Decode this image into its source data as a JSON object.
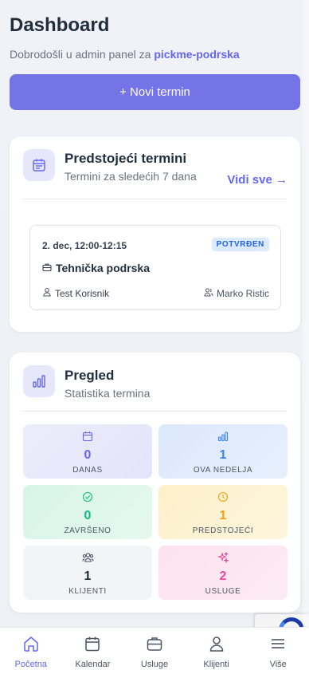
{
  "header": {
    "title": "Dashboard",
    "welcome": "Dobrodošli u admin panel za",
    "org": "pickme-podrska",
    "new_button": "+ Novi termin"
  },
  "upcoming": {
    "title": "Predstojeći termini",
    "subtitle": "Termini za sledećih 7 dana",
    "see_all": "Vidi sve →",
    "appointment": {
      "datetime": "2. dec, 12:00-12:15",
      "status": "POTVRĐEN",
      "service": "Tehnička podrska",
      "client": "Test Korisnik",
      "staff": "Marko Ristic"
    }
  },
  "overview": {
    "title": "Pregled",
    "subtitle": "Statistika termina",
    "stats": [
      {
        "value": "0",
        "label": "DANAS",
        "icon": "calendar-icon",
        "color": "#6366f1"
      },
      {
        "value": "1",
        "label": "OVA NEDELJA",
        "icon": "bar-chart-icon",
        "color": "#3b82f6"
      },
      {
        "value": "0",
        "label": "ZAVRŠENO",
        "icon": "check-circle-icon",
        "color": "#10b981"
      },
      {
        "value": "1",
        "label": "PREDSTOJEĆI",
        "icon": "clock-icon",
        "color": "#f59e0b"
      },
      {
        "value": "1",
        "label": "KLIJENTI",
        "icon": "users-icon",
        "color": "#4b5563"
      },
      {
        "value": "2",
        "label": "USLUGE",
        "icon": "sparkles-icon",
        "color": "#ec4899"
      }
    ]
  },
  "nav": {
    "items": [
      {
        "label": "Početna",
        "icon": "home-icon",
        "active": true
      },
      {
        "label": "Kalendar",
        "icon": "calendar-icon",
        "active": false
      },
      {
        "label": "Usluge",
        "icon": "briefcase-icon",
        "active": false
      },
      {
        "label": "Klijenti",
        "icon": "user-icon",
        "active": false
      },
      {
        "label": "Više",
        "icon": "menu-icon",
        "active": false
      }
    ]
  },
  "colors": {
    "accent": "#6366f1",
    "button": "#7474e6"
  }
}
